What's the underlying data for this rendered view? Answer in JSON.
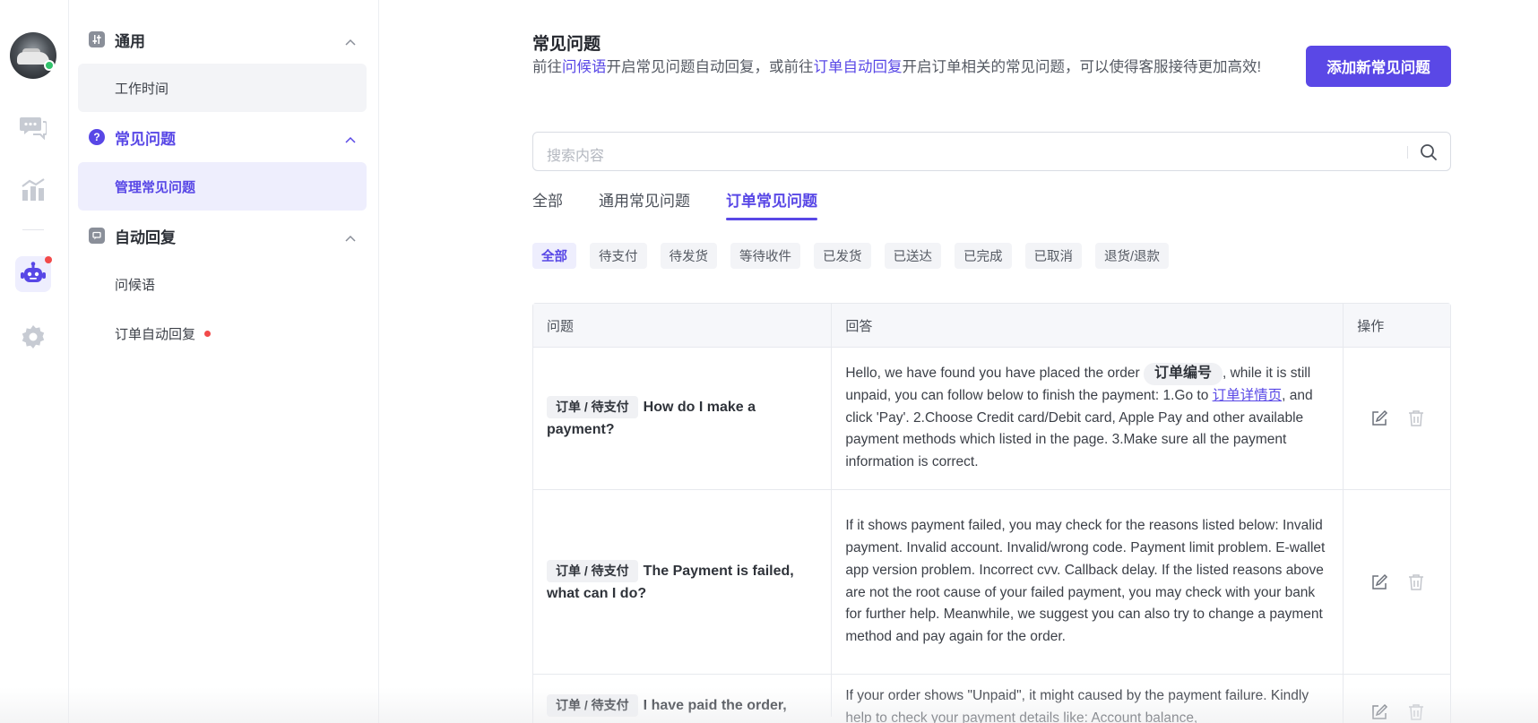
{
  "rail": {
    "items": [
      {
        "name": "chat",
        "icon": "chat-bubbles-icon"
      },
      {
        "name": "stats",
        "icon": "bar-chart-icon"
      },
      {
        "name": "robot",
        "icon": "robot-icon",
        "active": true,
        "badge": true
      },
      {
        "name": "settings",
        "icon": "gear-icon"
      }
    ]
  },
  "menu": {
    "general": {
      "label": "通用",
      "items": [
        "工作时间"
      ]
    },
    "faq": {
      "label": "常见问题",
      "items": [
        "管理常见问题"
      ]
    },
    "auto_reply": {
      "label": "自动回复",
      "items": [
        "问候语",
        "订单自动回复"
      ]
    }
  },
  "page": {
    "title": "常见问题",
    "desc_1": "前往",
    "desc_link_1": "问候语",
    "desc_2": "开启常见问题自动回复，或前往",
    "desc_link_2": "订单自动回复",
    "desc_3": "开启订单相关的常见问题，可以使得客服接待更加高效!",
    "add_button": "添加新常见问题"
  },
  "search": {
    "placeholder": "搜索内容"
  },
  "tabs": [
    "全部",
    "通用常见问题",
    "订单常见问题"
  ],
  "active_tab": "订单常见问题",
  "chips": [
    "全部",
    "待支付",
    "待发货",
    "等待收件",
    "已发货",
    "已送达",
    "已完成",
    "已取消",
    "退货/退款"
  ],
  "active_chip": "全部",
  "table": {
    "headers": [
      "问题",
      "回答",
      "操作"
    ],
    "rows": [
      {
        "tag": "订单 / 待支付",
        "question": "How do I make a payment?",
        "answer_1": "Hello, we have found you have placed the order ",
        "answer_token": "订单编号",
        "answer_2": ", while it is still unpaid, you can follow below to finish the payment: 1.Go to ",
        "answer_link": "订单详情页",
        "answer_3": ", and click 'Pay'. 2.Choose Credit card/Debit card, Apple Pay and other available payment methods which listed in the page. 3.Make sure all the payment information is correct."
      },
      {
        "tag": "订单 / 待支付",
        "question": "The Payment is failed, what can I do?",
        "answer": "If it shows payment failed, you may check for the reasons listed below: Invalid payment. Invalid account. Invalid/wrong code. Payment limit problem. E-wallet app version problem. Incorrect cvv. Callback delay. If the listed reasons above are not the root cause of your failed payment, you may check with your bank for further help. Meanwhile, we suggest you can also try to change a payment method and pay again for the order."
      },
      {
        "tag": "订单 / 待支付",
        "question": "I have paid the order,",
        "answer": "If your order shows \"Unpaid\", it might caused by the payment failure. Kindly help to check your payment details like: Account balance,"
      }
    ]
  },
  "colors": {
    "accent": "#5847e6",
    "online": "#32c36c",
    "badge": "#f24a4a"
  }
}
